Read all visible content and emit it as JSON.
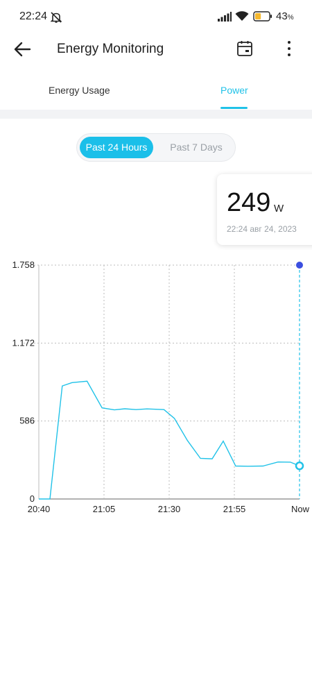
{
  "status_bar": {
    "time": "22:24",
    "battery_percent": "43",
    "battery_suffix": "%",
    "battery_level": 0.43,
    "battery_color": "#f5b82e"
  },
  "header": {
    "title": "Energy Monitoring",
    "back_icon": "arrow-left-icon",
    "calendar_icon": "calendar-icon",
    "more_icon": "more-vertical-icon"
  },
  "tabs": [
    {
      "label": "Energy Usage",
      "active": false
    },
    {
      "label": "Power",
      "active": true
    }
  ],
  "accent_color": "#20c2e8",
  "range_toggle": {
    "options": [
      "Past 24 Hours",
      "Past 7 Days"
    ],
    "selected": "Past 24 Hours"
  },
  "readout": {
    "value": "249",
    "unit": "W",
    "timestamp": "22:24  авг 24, 2023"
  },
  "chart_data": {
    "type": "line",
    "ylim": [
      0,
      1758
    ],
    "y_ticks": [
      {
        "value": 0,
        "label": "0"
      },
      {
        "value": 586,
        "label": "586"
      },
      {
        "value": 1172,
        "label": "1.172"
      },
      {
        "value": 1758,
        "label": "1.758"
      }
    ],
    "x_ticks": [
      {
        "index": 0,
        "label": "20:40"
      },
      {
        "index": 5,
        "label": "21:05"
      },
      {
        "index": 10,
        "label": "21:30"
      },
      {
        "index": 15,
        "label": "21:55"
      },
      {
        "index": 20,
        "label": "Now"
      }
    ],
    "x_max_index": 20,
    "values": [
      0,
      0,
      850,
      875,
      885,
      685,
      670,
      678,
      672,
      677,
      672,
      606,
      440,
      305,
      302,
      435,
      248,
      246,
      248,
      278,
      277,
      249
    ],
    "x": [
      0,
      0.85,
      1.8,
      2.55,
      3.7,
      4.85,
      5.8,
      6.6,
      7.45,
      8.3,
      9.6,
      10.4,
      11.4,
      12.4,
      13.3,
      14.15,
      15.1,
      16.05,
      17.2,
      18.35,
      19.3,
      20
    ],
    "line_color": "#20c2e8",
    "marker_color": "#3b4fe0",
    "grid": true
  }
}
